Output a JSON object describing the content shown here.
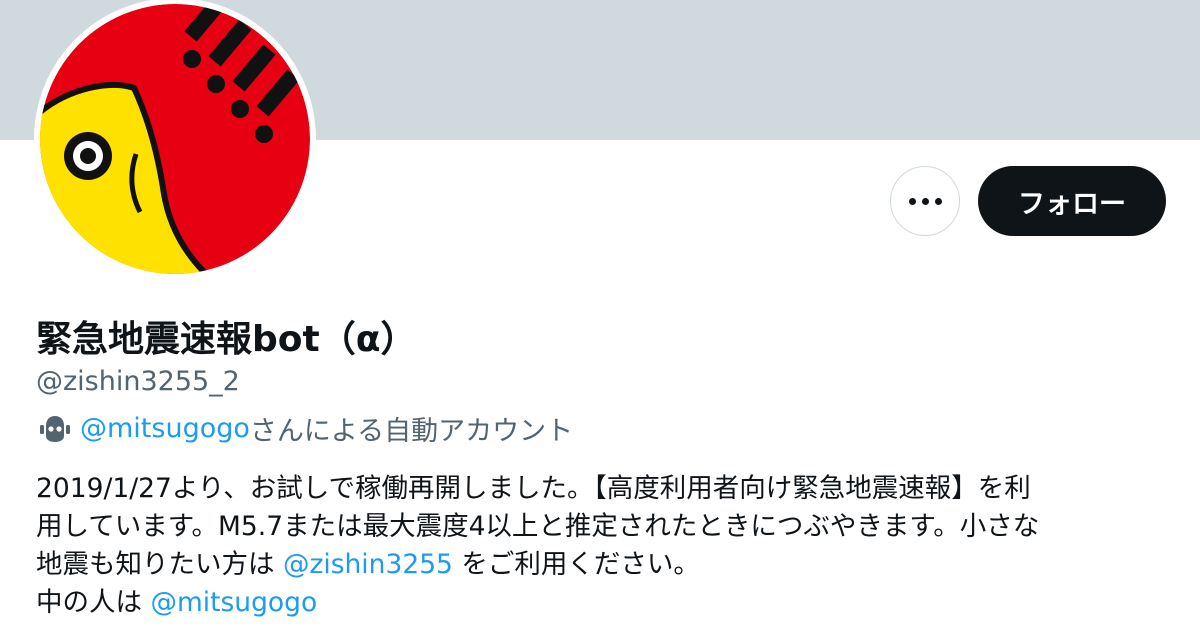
{
  "profile": {
    "name": "緊急地震速報bot（α）",
    "handle": "@zishin3255_2",
    "automated": {
      "operator": "@mitsugogo",
      "suffix": "さんによる自動アカウント"
    },
    "bio": {
      "line1": "2019/1/27より、お試しで稼働再開しました。【高度利用者向け緊急地震速報】を利",
      "line2": "用しています。M5.7または最大震度4以上と推定されたときにつぶやきます。小さな",
      "line3_pre": "地震も知りたい方は ",
      "line3_link": "@zishin3255",
      "line3_post": " をご利用ください。",
      "line4_pre": "中の人は ",
      "line4_link": "@mitsugogo"
    }
  },
  "actions": {
    "more_icon": "more-horizontal-icon",
    "follow_label": "フォロー"
  },
  "colors": {
    "banner": "#cfd9de",
    "link": "#1d9bf0",
    "avatar_red": "#e60012",
    "avatar_yellow": "#ffe100",
    "follow_bg": "#0f1419"
  }
}
